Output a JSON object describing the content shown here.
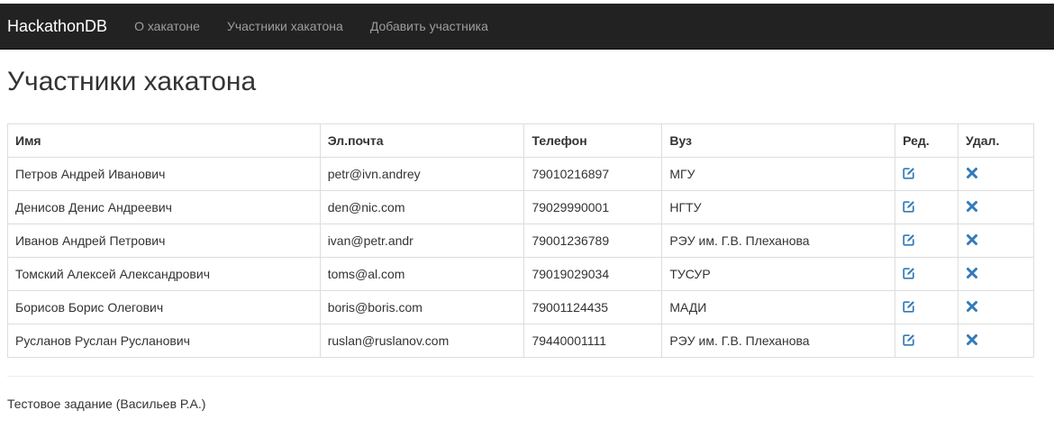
{
  "navbar": {
    "brand": "HackathonDB",
    "links": [
      "О хакатоне",
      "Участники хакатона",
      "Добавить участника"
    ]
  },
  "page_title": "Участники хакатона",
  "table": {
    "headers": [
      "Имя",
      "Эл.почта",
      "Телефон",
      "Вуз",
      "Ред.",
      "Удал."
    ],
    "rows": [
      [
        "Петров Андрей Иванович",
        "petr@ivn.andrey",
        "79010216897",
        "МГУ"
      ],
      [
        "Денисов Денис Андреевич",
        "den@nic.com",
        "79029990001",
        "НГТУ"
      ],
      [
        "Иванов Андрей Петрович",
        "ivan@petr.andr",
        "79001236789",
        "РЭУ им. Г.В. Плеханова"
      ],
      [
        "Томский Алексей Александрович",
        "toms@al.com",
        "79019029034",
        "ТУСУР"
      ],
      [
        "Борисов Борис Олегович",
        "boris@boris.com",
        "79001124435",
        "МАДИ"
      ],
      [
        "Русланов Руслан Русланович",
        "ruslan@ruslanov.com",
        "79440001111",
        "РЭУ им. Г.В. Плеханова"
      ]
    ]
  },
  "icons": {
    "edit": "edit-icon",
    "delete": "remove-icon"
  },
  "colors": {
    "navbar_bg": "#222222",
    "icon_blue": "#337ab7"
  },
  "footer": "Тестовое задание (Васильев Р.А.)"
}
